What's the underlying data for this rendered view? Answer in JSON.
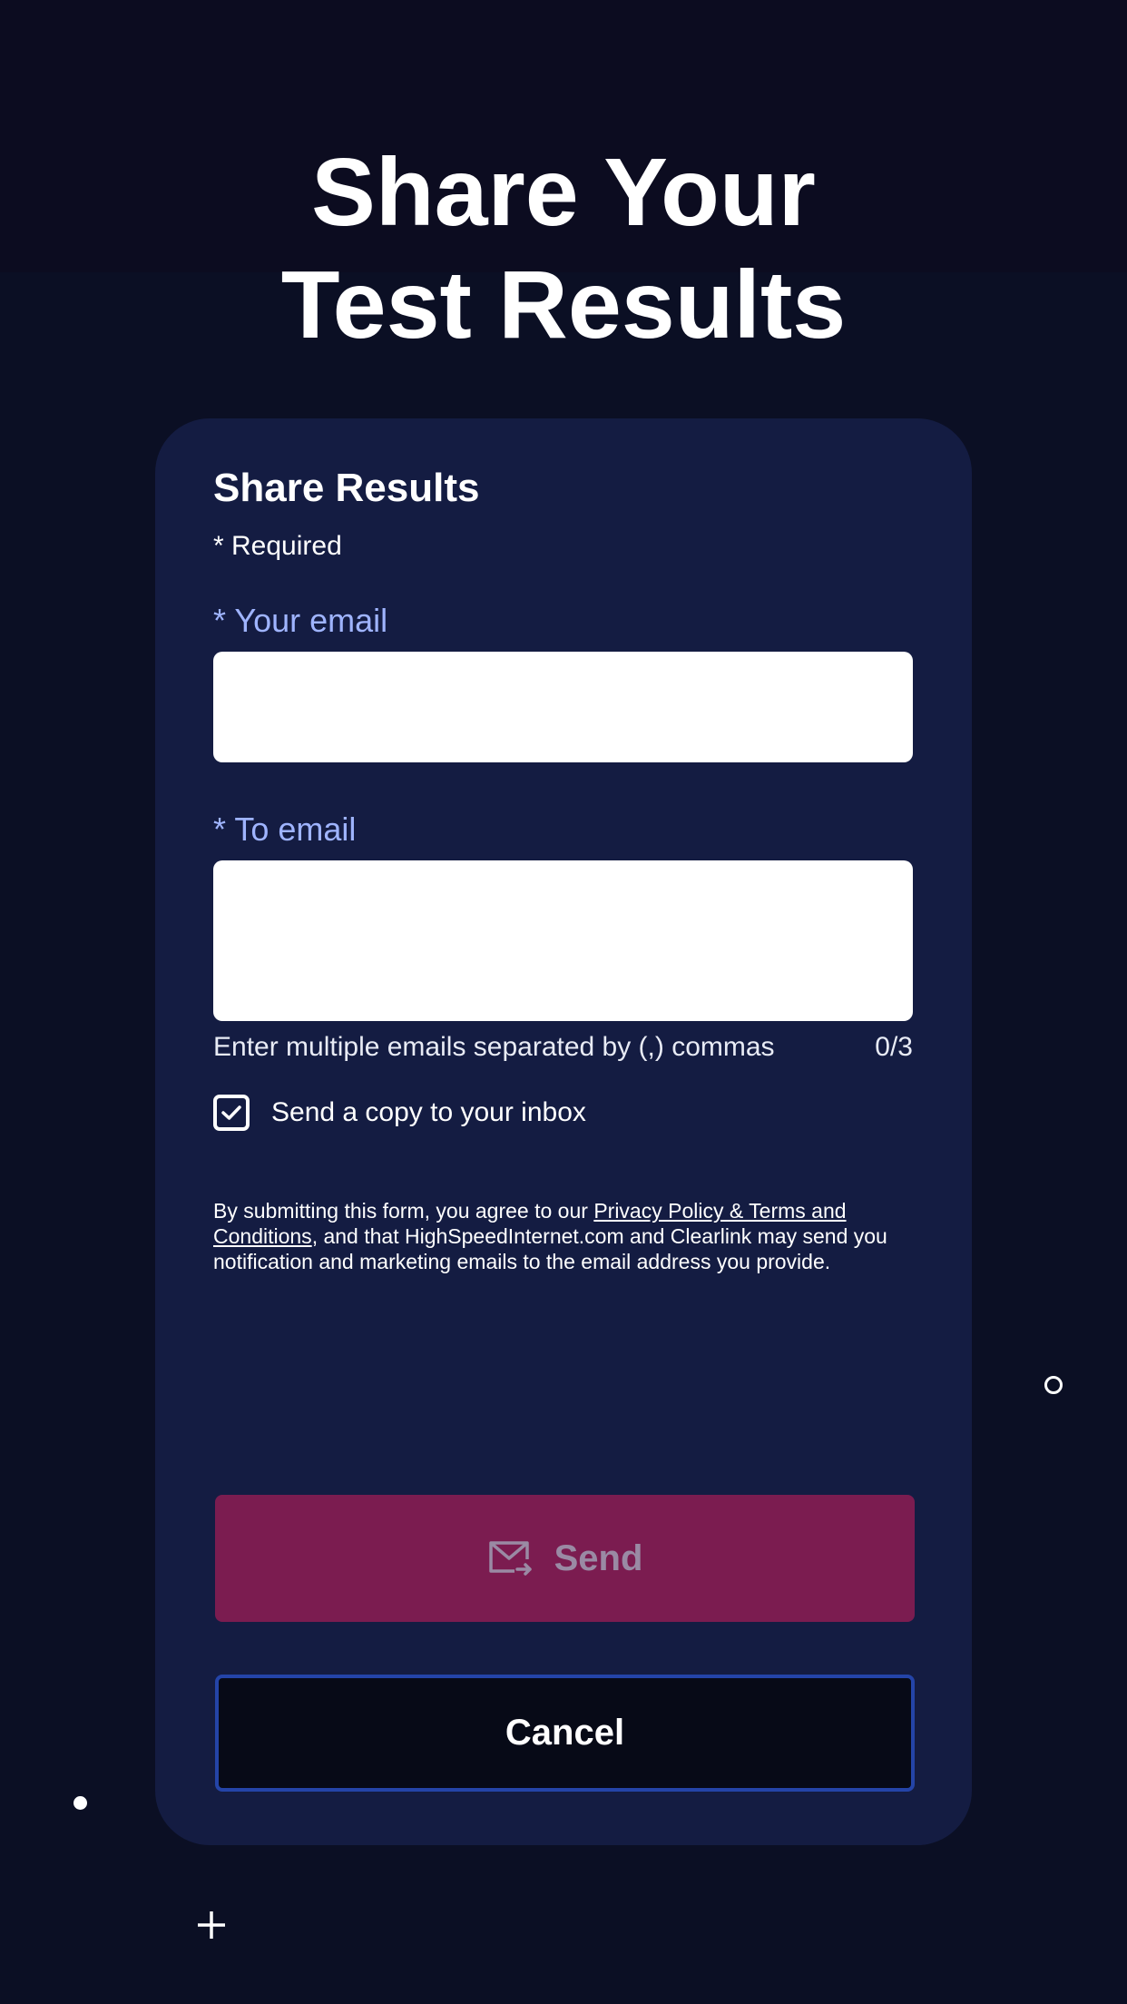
{
  "header": {
    "title_line1": "Share Your",
    "title_line2": "Test Results"
  },
  "form": {
    "title": "Share Results",
    "required_note": "* Required",
    "your_email": {
      "label": "* Your email",
      "value": "",
      "placeholder": ""
    },
    "to_email": {
      "label": "* To email",
      "value": "",
      "placeholder": "",
      "helper": "Enter multiple emails separated by (,) commas",
      "counter": "0/3"
    },
    "send_copy": {
      "label": "Send a copy to your inbox",
      "checked": true
    },
    "legal": {
      "prefix": "By submitting this form, you agree to our ",
      "link_text": "Privacy Policy & Terms and Conditions",
      "suffix": ", and that HighSpeedInternet.com and Clearlink may send you notification and marketing emails to the email address you provide."
    },
    "send_button": {
      "label": "Send",
      "icon": "mail-send-icon",
      "color": "#7b1c50"
    },
    "cancel_button": {
      "label": "Cancel"
    }
  },
  "colors": {
    "background": "#0b0f24",
    "card": "#141c42",
    "label_accent": "#9fb4ff",
    "cancel_border": "#2444a8"
  },
  "decorations": [
    "ring-icon",
    "dot-icon",
    "plus-icon"
  ]
}
